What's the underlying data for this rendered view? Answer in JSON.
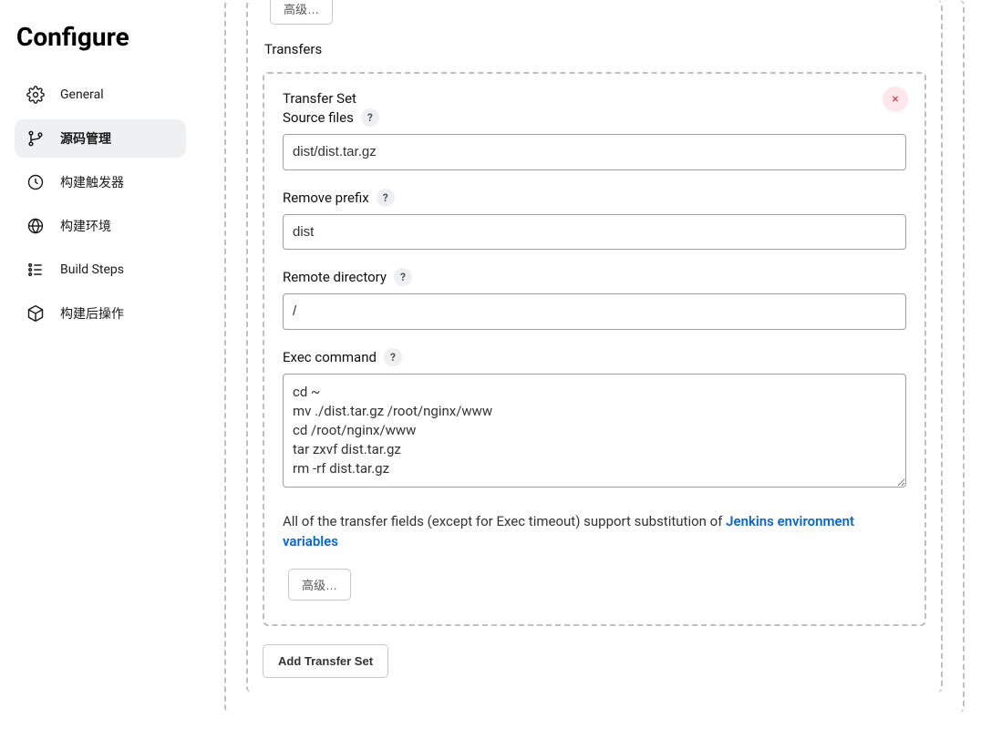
{
  "sidebar": {
    "title": "Configure",
    "items": [
      {
        "label": "General"
      },
      {
        "label": "源码管理"
      },
      {
        "label": "构建触发器"
      },
      {
        "label": "构建环境"
      },
      {
        "label": "Build Steps"
      },
      {
        "label": "构建后操作"
      }
    ],
    "active_index": 1
  },
  "transfers": {
    "top_advanced_label": "高级…",
    "section_label": "Transfers",
    "set_title": "Transfer Set",
    "close_icon_label": "×",
    "source_files": {
      "label": "Source files",
      "value": "dist/dist.tar.gz"
    },
    "remove_prefix": {
      "label": "Remove prefix",
      "value": "dist"
    },
    "remote_directory": {
      "label": "Remote directory",
      "value": "/"
    },
    "exec_command": {
      "label": "Exec command",
      "value": "cd ~\nmv ./dist.tar.gz /root/nginx/www\ncd /root/nginx/www\ntar zxvf dist.tar.gz\nrm -rf dist.tar.gz"
    },
    "hint": {
      "prefix": "All of the transfer fields (except for Exec timeout) support substitution of ",
      "link_text": "Jenkins environment variables"
    },
    "inner_advanced_label": "高级…",
    "add_transfer_set_label": "Add Transfer Set",
    "help_glyph": "?"
  }
}
